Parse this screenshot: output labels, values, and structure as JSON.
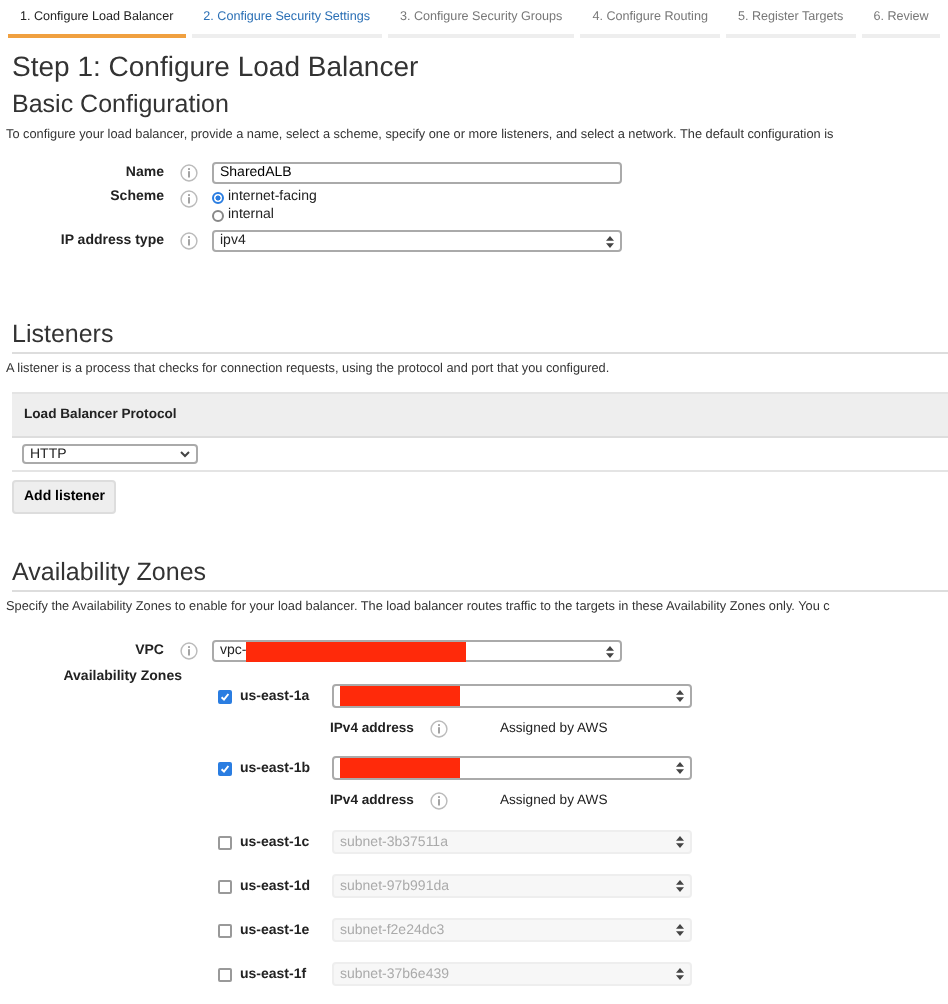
{
  "steps": [
    {
      "label": "1. Configure Load Balancer",
      "selected": true
    },
    {
      "label": "2. Configure Security Settings",
      "selected": false,
      "link": true
    },
    {
      "label": "3. Configure Security Groups",
      "selected": false,
      "link": false
    },
    {
      "label": "4. Configure Routing",
      "selected": false,
      "link": false
    },
    {
      "label": "5. Register Targets",
      "selected": false,
      "link": false
    },
    {
      "label": "6. Review",
      "selected": false,
      "link": false
    }
  ],
  "title": "Step 1: Configure Load Balancer",
  "basic": {
    "heading": "Basic Configuration",
    "description": "To configure your load balancer, provide a name, select a scheme, specify one or more listeners, and select a network. The default configuration is",
    "name": {
      "label": "Name",
      "value": "SharedALB"
    },
    "scheme": {
      "label": "Scheme",
      "options": [
        {
          "label": "internet-facing",
          "selected": true
        },
        {
          "label": "internal",
          "selected": false
        }
      ]
    },
    "ip_type": {
      "label": "IP address type",
      "value": "ipv4"
    }
  },
  "listeners": {
    "heading": "Listeners",
    "description": "A listener is a process that checks for connection requests, using the protocol and port that you configured.",
    "column": "Load Balancer Protocol",
    "protocol": "HTTP",
    "button": "Add listener"
  },
  "zones": {
    "heading": "Availability Zones",
    "description": "Specify the Availability Zones to enable for your load balancer. The load balancer routes traffic to the targets in these Availability Zones only. You c",
    "vpc": {
      "label": "VPC",
      "value": "vpc-",
      "redacted": true
    },
    "label": "Availability Zones",
    "items": [
      {
        "zone": "us-east-1a",
        "checked": true,
        "redacted": true,
        "ipv4_label": "IPv4 address",
        "ipv4_value": "Assigned by AWS"
      },
      {
        "zone": "us-east-1b",
        "checked": true,
        "redacted": true,
        "ipv4_label": "IPv4 address",
        "ipv4_value": "Assigned by AWS"
      },
      {
        "zone": "us-east-1c",
        "checked": false,
        "subnet": "subnet-3b37511a"
      },
      {
        "zone": "us-east-1d",
        "checked": false,
        "subnet": "subnet-97b991da"
      },
      {
        "zone": "us-east-1e",
        "checked": false,
        "subnet": "subnet-f2e24dc3"
      },
      {
        "zone": "us-east-1f",
        "checked": false,
        "subnet": "subnet-37b6e439"
      }
    ]
  }
}
